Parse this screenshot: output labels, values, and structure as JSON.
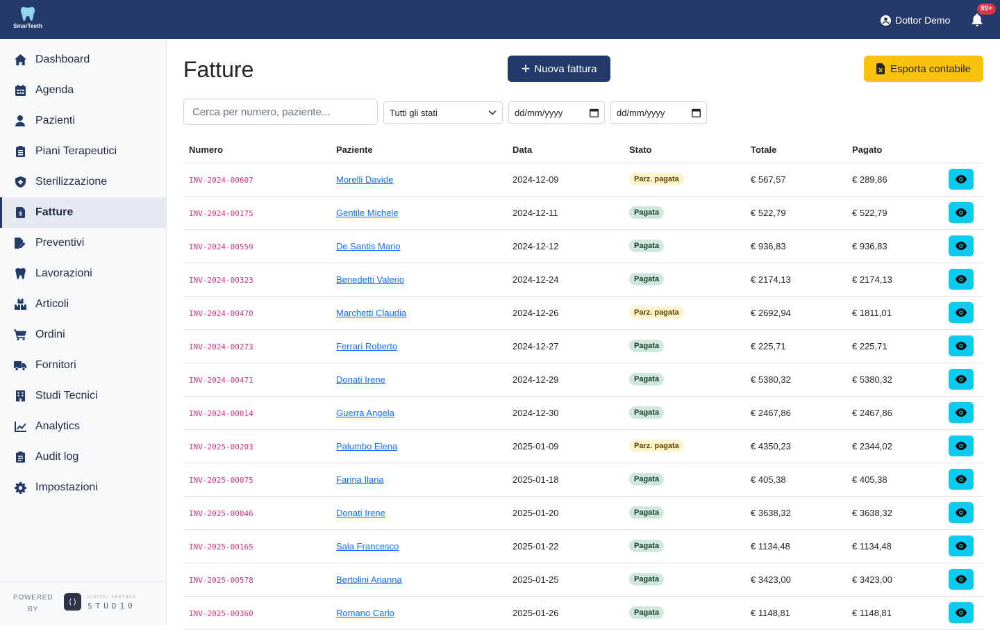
{
  "header": {
    "logo_text": "SmarTeeth",
    "user_name": "Dottor Demo",
    "notifications_badge": "99+"
  },
  "sidebar": {
    "items": [
      {
        "label": "Dashboard",
        "icon": "home-icon"
      },
      {
        "label": "Agenda",
        "icon": "calendar-icon"
      },
      {
        "label": "Pazienti",
        "icon": "user-icon"
      },
      {
        "label": "Piani Terapeutici",
        "icon": "clipboard-icon"
      },
      {
        "label": "Sterilizzazione",
        "icon": "shield-icon"
      },
      {
        "label": "Fatture",
        "icon": "invoice-icon",
        "active": true
      },
      {
        "label": "Preventivi",
        "icon": "file-edit-icon"
      },
      {
        "label": "Lavorazioni",
        "icon": "tooth-icon"
      },
      {
        "label": "Articoli",
        "icon": "boxes-icon"
      },
      {
        "label": "Ordini",
        "icon": "cart-icon"
      },
      {
        "label": "Fornitori",
        "icon": "truck-icon"
      },
      {
        "label": "Studi Tecnici",
        "icon": "building-icon"
      },
      {
        "label": "Analytics",
        "icon": "chart-line-icon"
      },
      {
        "label": "Audit log",
        "icon": "clipboard-list-icon"
      },
      {
        "label": "Impostazioni",
        "icon": "gear-icon"
      }
    ],
    "footer": {
      "powered_line1": "POWERED",
      "powered_line2": "BY",
      "studio_mark": "⟨⟩",
      "studio_sub": "DIGITAL PARTNER",
      "studio_name": "STUD10"
    }
  },
  "page": {
    "title": "Fatture",
    "new_button_label": "Nuova fattura",
    "export_button_label": "Esporta contabile"
  },
  "filters": {
    "search_placeholder": "Cerca per numero, paziente...",
    "status_value": "Tutti gli stati",
    "date_from": "dd/mm/yyyy",
    "date_to": "dd/mm/yyyy"
  },
  "table": {
    "headers": [
      "Numero",
      "Paziente",
      "Data",
      "Stato",
      "Totale",
      "Pagato"
    ],
    "rows": [
      {
        "numero": "INV-2024-00607",
        "paziente": "Morelli Davide",
        "data": "2024-12-09",
        "stato": "Parz. pagata",
        "totale": "€ 567,57",
        "pagato": "€ 289,86"
      },
      {
        "numero": "INV-2024-00175",
        "paziente": "Gentile Michele",
        "data": "2024-12-11",
        "stato": "Pagata",
        "totale": "€ 522,79",
        "pagato": "€ 522,79"
      },
      {
        "numero": "INV-2024-00559",
        "paziente": "De Santis Mario",
        "data": "2024-12-12",
        "stato": "Pagata",
        "totale": "€ 936,83",
        "pagato": "€ 936,83"
      },
      {
        "numero": "INV-2024-00323",
        "paziente": "Benedetti Valerio",
        "data": "2024-12-24",
        "stato": "Pagata",
        "totale": "€ 2174,13",
        "pagato": "€ 2174,13"
      },
      {
        "numero": "INV-2024-00470",
        "paziente": "Marchetti Claudia",
        "data": "2024-12-26",
        "stato": "Parz. pagata",
        "totale": "€ 2692,94",
        "pagato": "€ 1811,01"
      },
      {
        "numero": "INV-2024-00273",
        "paziente": "Ferrari Roberto",
        "data": "2024-12-27",
        "stato": "Pagata",
        "totale": "€ 225,71",
        "pagato": "€ 225,71"
      },
      {
        "numero": "INV-2024-00471",
        "paziente": "Donati Irene",
        "data": "2024-12-29",
        "stato": "Pagata",
        "totale": "€ 5380,32",
        "pagato": "€ 5380,32"
      },
      {
        "numero": "INV-2024-00014",
        "paziente": "Guerra Angela",
        "data": "2024-12-30",
        "stato": "Pagata",
        "totale": "€ 2467,86",
        "pagato": "€ 2467,86"
      },
      {
        "numero": "INV-2025-00203",
        "paziente": "Palumbo Elena",
        "data": "2025-01-09",
        "stato": "Parz. pagata",
        "totale": "€ 4350,23",
        "pagato": "€ 2344,02"
      },
      {
        "numero": "INV-2025-00075",
        "paziente": "Farina Ilaria",
        "data": "2025-01-18",
        "stato": "Pagata",
        "totale": "€ 405,38",
        "pagato": "€ 405,38"
      },
      {
        "numero": "INV-2025-00046",
        "paziente": "Donati Irene",
        "data": "2025-01-20",
        "stato": "Pagata",
        "totale": "€ 3638,32",
        "pagato": "€ 3638,32"
      },
      {
        "numero": "INV-2025-00165",
        "paziente": "Sala Francesco",
        "data": "2025-01-22",
        "stato": "Pagata",
        "totale": "€ 1134,48",
        "pagato": "€ 1134,48"
      },
      {
        "numero": "INV-2025-00578",
        "paziente": "Bertolini Arianna",
        "data": "2025-01-25",
        "stato": "Pagata",
        "totale": "€ 3423,00",
        "pagato": "€ 3423,00"
      },
      {
        "numero": "INV-2025-00360",
        "paziente": "Romano Carlo",
        "data": "2025-01-26",
        "stato": "Pagata",
        "totale": "€ 1148,81",
        "pagato": "€ 1148,81"
      }
    ]
  },
  "colors": {
    "topbar": "#233a6b",
    "primary_button": "#233a6b",
    "export_button": "#f8c20f",
    "view_button": "#0dcaf0",
    "invoice_number": "#d63384",
    "badge_paid_bg": "#d1e7dd",
    "badge_partial_bg": "#fff3cd"
  }
}
